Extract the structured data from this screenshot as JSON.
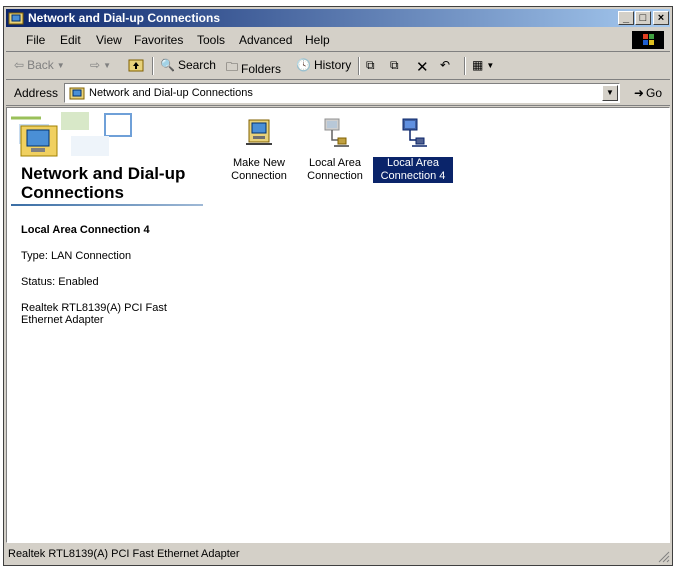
{
  "window": {
    "title": "Network and Dial-up Connections",
    "controls": {
      "minimize": "_",
      "maximize": "□",
      "close": "×"
    }
  },
  "menu": [
    "File",
    "Edit",
    "View",
    "Favorites",
    "Tools",
    "Advanced",
    "Help"
  ],
  "toolbar": {
    "back": "Back",
    "search": "Search",
    "folders": "Folders",
    "history": "History"
  },
  "address": {
    "label": "Address",
    "value": "Network and Dial-up Connections",
    "go": "Go"
  },
  "pane": {
    "title": "Network and Dial-up Connections",
    "selected_name": "Local Area Connection 4",
    "type": "Type: LAN Connection",
    "status": "Status: Enabled",
    "adapter": "Realtek RTL8139(A) PCI Fast Ethernet Adapter"
  },
  "icons": [
    {
      "label": "Make New Connection",
      "selected": false,
      "icon": "make-new-connection-icon"
    },
    {
      "label": "Local Area Connection",
      "selected": false,
      "icon": "lan-connection-disabled-icon"
    },
    {
      "label": "Local Area Connection 4",
      "selected": true,
      "icon": "lan-connection-icon"
    }
  ],
  "statusbar": {
    "text": "Realtek RTL8139(A) PCI Fast Ethernet Adapter"
  },
  "colors": {
    "title_start": "#0a246a",
    "title_end": "#a6caf0",
    "chrome": "#d4d0c8",
    "selection": "#0a246a"
  }
}
